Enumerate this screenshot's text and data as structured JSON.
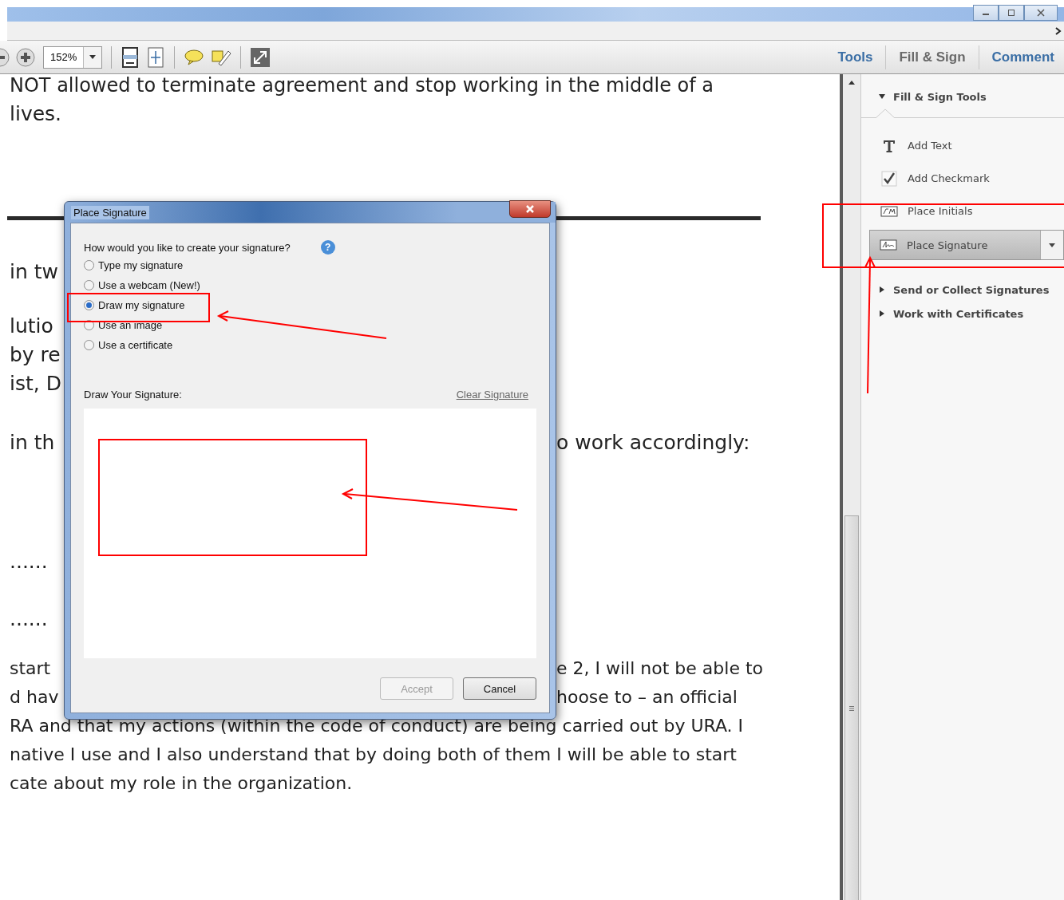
{
  "toolbar": {
    "zoom": "152%"
  },
  "tabs": [
    {
      "label": "Tools",
      "selected": false
    },
    {
      "label": "Fill & Sign",
      "selected": true
    },
    {
      "label": "Comment",
      "selected": false
    }
  ],
  "document": {
    "lines": [
      {
        "kind": "text",
        "text": "NOT allowed to terminate agreement and stop working in the middle of a"
      },
      {
        "kind": "text",
        "text": "lives."
      },
      {
        "kind": "rule"
      },
      {
        "kind": "text",
        "left": "in tw"
      },
      {
        "kind": "text",
        "left": "lutio"
      },
      {
        "kind": "text",
        "left": "by re"
      },
      {
        "kind": "text",
        "left": "ist, D"
      },
      {
        "kind": "text",
        "left": "in th",
        "right": "o work accordingly:"
      },
      {
        "kind": "text",
        "left": "......"
      },
      {
        "kind": "text",
        "left": "......"
      },
      {
        "kind": "text",
        "left": "start",
        "right": "e 2, I will not be able to"
      },
      {
        "kind": "text",
        "left": "d hav",
        "right": "hoose to – an official"
      },
      {
        "kind": "text",
        "text": "RA and that my actions (within the code of conduct) are being carried out by URA. I"
      },
      {
        "kind": "text",
        "text": "native I use and I also understand that by doing both of them I will be able to start"
      },
      {
        "kind": "text",
        "text": "cate about my role in the organization."
      }
    ]
  },
  "dialog": {
    "title": "Place Signature",
    "question": "How would you like to create your signature?",
    "help": "?",
    "options": [
      {
        "label": "Type my signature",
        "selected": false
      },
      {
        "label": "Use a webcam (New!)",
        "selected": false
      },
      {
        "label": "Draw my signature",
        "selected": true
      },
      {
        "label": "Use an image",
        "selected": false
      },
      {
        "label": "Use a certificate",
        "selected": false
      }
    ],
    "draw_label": "Draw Your Signature:",
    "clear_link": "Clear Signature",
    "buttons": [
      {
        "label": "Accept",
        "disabled": true
      },
      {
        "label": "Cancel",
        "disabled": false
      }
    ]
  },
  "panel": {
    "section": {
      "title": "Fill & Sign Tools",
      "expanded": true
    },
    "items": [
      {
        "kind": "text",
        "label": "Add Text",
        "selected": false
      },
      {
        "kind": "check",
        "label": "Add Checkmark",
        "selected": false
      },
      {
        "kind": "initials",
        "label": "Place Initials",
        "selected": false
      },
      {
        "kind": "signature",
        "label": "Place Signature",
        "selected": true
      }
    ],
    "sections": [
      {
        "title": "Send or Collect Signatures",
        "expanded": false
      },
      {
        "title": "Work with Certificates",
        "expanded": false
      }
    ]
  }
}
